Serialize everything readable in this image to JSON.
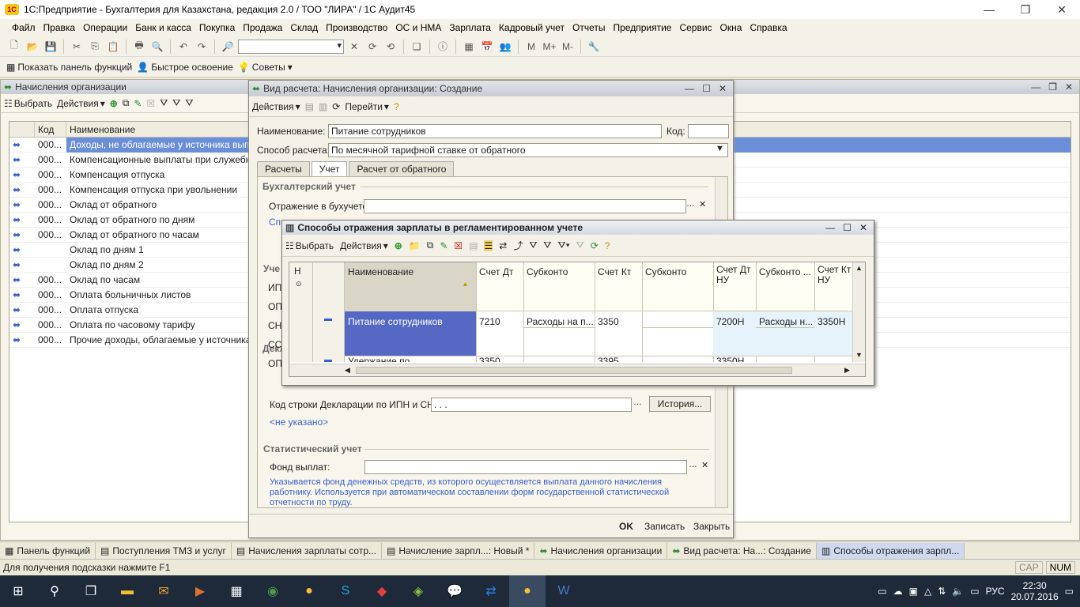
{
  "app": {
    "title": "1С:Предприятие - Бухгалтерия для Казахстана, редакция 2.0 / ТОО \"ЛИРА\" / 1С Аудит45"
  },
  "menu": [
    "Файл",
    "Правка",
    "Операции",
    "Банк и касса",
    "Покупка",
    "Продажа",
    "Склад",
    "Производство",
    "ОС и НМА",
    "Зарплата",
    "Кадровый учет",
    "Отчеты",
    "Предприятие",
    "Сервис",
    "Окна",
    "Справка"
  ],
  "toolbar2": {
    "show_panel": "Показать панель функций",
    "quick": "Быстрое освоение",
    "tips": "Советы"
  },
  "list": {
    "title": "Начисления организации",
    "select": "Выбрать",
    "actions": "Действия",
    "col_code": "Код",
    "col_name": "Наименование",
    "rows": [
      {
        "code": "000...",
        "name": "Доходы, не облагаемые у источника выплат"
      },
      {
        "code": "000...",
        "name": "Компенсационные выплаты при служебных"
      },
      {
        "code": "000...",
        "name": "Компенсация отпуска"
      },
      {
        "code": "000...",
        "name": "Компенсация отпуска при увольнении"
      },
      {
        "code": "000...",
        "name": "Оклад от обратного"
      },
      {
        "code": "000...",
        "name": "Оклад от обратного по дням"
      },
      {
        "code": "000...",
        "name": "Оклад от обратного по часам"
      },
      {
        "code": "",
        "name": "Оклад по дням 1"
      },
      {
        "code": "",
        "name": "Оклад по дням 2"
      },
      {
        "code": "000...",
        "name": "Оклад по часам"
      },
      {
        "code": "000...",
        "name": "Оплата больничных листов"
      },
      {
        "code": "000...",
        "name": "Оплата отпуска"
      },
      {
        "code": "000...",
        "name": "Оплата по часовому тарифу"
      },
      {
        "code": "000...",
        "name": "Прочие доходы, облагаемые у источника"
      }
    ]
  },
  "form": {
    "title": "Вид расчета: Начисления организации: Создание",
    "actions": "Действия",
    "goto": "Перейти",
    "name_label": "Наименование:",
    "name_value": "Питание сотрудников",
    "code_label": "Код:",
    "method_label": "Способ расчета:",
    "method_value": "По месячной тарифной ставке от обратного",
    "tabs": [
      "Расчеты",
      "Учет",
      "Расчет от обратного"
    ],
    "sect_acc": "Бухгалтерский учет",
    "refl_label": "Отражение в бухучете:",
    "sp_stub": "Сп",
    "side_stubs": [
      "Уче",
      "ИП",
      "ОП",
      "СН",
      "СС",
      "ОП"
    ],
    "sect_decl": "Декларация по ИПН и СН",
    "decl_label": "Код строки Декларации по ИПН и СН:",
    "decl_value": ".   .   .",
    "history": "История...",
    "not_set": "<не указано>",
    "sect_stat": "Статистический учет",
    "fund_label": "Фонд выплат:",
    "hint": "Указывается фонд денежных средств, из которого осуществляется выплата данного начисления работнику. Используется при автоматическом составлении форм государственной статистической отчетности по труду.",
    "ok": "OK",
    "save": "Записать",
    "close": "Закрыть"
  },
  "popup": {
    "title": "Способы отражения зарплаты в регламентированном учете",
    "select": "Выбрать",
    "actions": "Действия",
    "n_col": "Н",
    "cols": [
      "Наименование",
      "Счет Дт",
      "Субконто",
      "Счет Кт",
      "Субконто",
      "Счет Дт НУ",
      "Субконто ...",
      "Счет Кт НУ"
    ],
    "row1": {
      "name": "Питание сотрудников",
      "dt": "7210",
      "sub1": "Расходы на п...",
      "kt": "3350",
      "sub2": "",
      "dt_nu": "7200Н",
      "sub3": "Расходы н...",
      "kt_nu": "3350Н"
    },
    "row2": {
      "name": "Удержание по...",
      "dt": "3350",
      "kt": "3395",
      "dt_nu": "3350Н"
    }
  },
  "tasks": [
    "Панель функций",
    "Поступления ТМЗ и услуг",
    "Начисления зарплаты сотр...",
    "Начисление зарпл...: Новый *",
    "Начисления организации",
    "Вид расчета: На...: Создание",
    "Способы отражения зарпл..."
  ],
  "status": {
    "hint": "Для получения подсказки нажмите F1",
    "cap": "CAP",
    "num": "NUM"
  },
  "clock": {
    "time": "22:30",
    "date": "20.07.2016",
    "lang": "РУС"
  },
  "colors": {
    "selection": "#6a8fd8",
    "link": "#3a5fcd",
    "accent": "#3a8a3a"
  }
}
